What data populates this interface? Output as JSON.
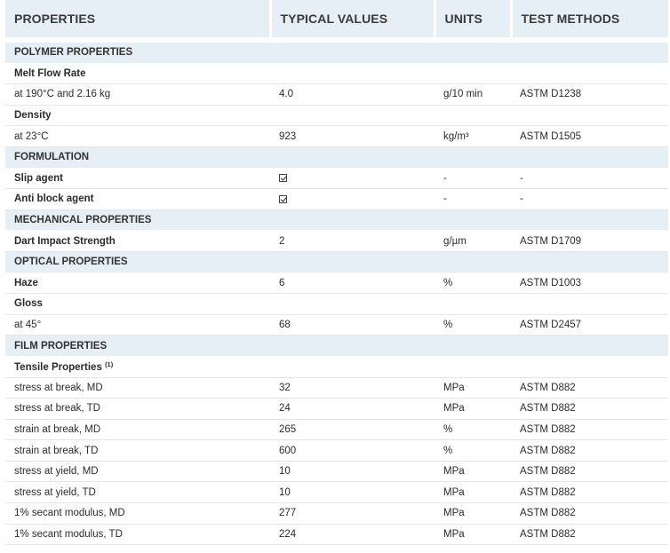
{
  "headers": [
    "PROPERTIES",
    "TYPICAL VALUES",
    "UNITS",
    "TEST METHODS"
  ],
  "rows": [
    {
      "type": "section",
      "label": "POLYMER PROPERTIES"
    },
    {
      "type": "sub",
      "label": "Melt Flow Rate"
    },
    {
      "type": "row",
      "label": "at 190°C and 2.16 kg",
      "value": "4.0",
      "unit": "g/10 min",
      "method": "ASTM D1238"
    },
    {
      "type": "sub",
      "label": "Density"
    },
    {
      "type": "row",
      "label": "at 23°C",
      "value": "923",
      "unit": "kg/m³",
      "method": "ASTM D1505"
    },
    {
      "type": "section",
      "label": "FORMULATION"
    },
    {
      "type": "row-bold",
      "label": "Slip agent",
      "value": "☑",
      "check": true,
      "unit": "-",
      "method": "-"
    },
    {
      "type": "row-bold",
      "label": "Anti block agent",
      "value": "☑",
      "check": true,
      "unit": "-",
      "method": "-"
    },
    {
      "type": "section",
      "label": "MECHANICAL PROPERTIES"
    },
    {
      "type": "row-bold",
      "label": "Dart Impact Strength",
      "value": "2",
      "unit": "g/µm",
      "method": "ASTM D1709"
    },
    {
      "type": "section",
      "label": "OPTICAL PROPERTIES"
    },
    {
      "type": "row-bold",
      "label": "Haze",
      "value": "6",
      "unit": "%",
      "method": "ASTM D1003"
    },
    {
      "type": "sub",
      "label": "Gloss"
    },
    {
      "type": "row",
      "label": "at 45°",
      "value": "68",
      "unit": "%",
      "method": "ASTM D2457"
    },
    {
      "type": "section",
      "label": "FILM PROPERTIES"
    },
    {
      "type": "sub",
      "label": "Tensile Properties",
      "sup": "(1)"
    },
    {
      "type": "row",
      "label": "stress at break, MD",
      "value": "32",
      "unit": "MPa",
      "method": "ASTM D882"
    },
    {
      "type": "row",
      "label": "stress at break, TD",
      "value": "24",
      "unit": "MPa",
      "method": "ASTM D882"
    },
    {
      "type": "row",
      "label": "strain at break, MD",
      "value": "265",
      "unit": "%",
      "method": "ASTM D882"
    },
    {
      "type": "row",
      "label": "strain at break, TD",
      "value": "600",
      "unit": "%",
      "method": "ASTM D882"
    },
    {
      "type": "row",
      "label": "stress at yield, MD",
      "value": "10",
      "unit": "MPa",
      "method": "ASTM D882"
    },
    {
      "type": "row",
      "label": "stress at yield, TD",
      "value": "10",
      "unit": "MPa",
      "method": "ASTM D882"
    },
    {
      "type": "row",
      "label": "1% secant modulus, MD",
      "value": "277",
      "unit": "MPa",
      "method": "ASTM D882"
    },
    {
      "type": "row",
      "label": "1% secant modulus, TD",
      "value": "224",
      "unit": "MPa",
      "method": "ASTM D882"
    }
  ]
}
